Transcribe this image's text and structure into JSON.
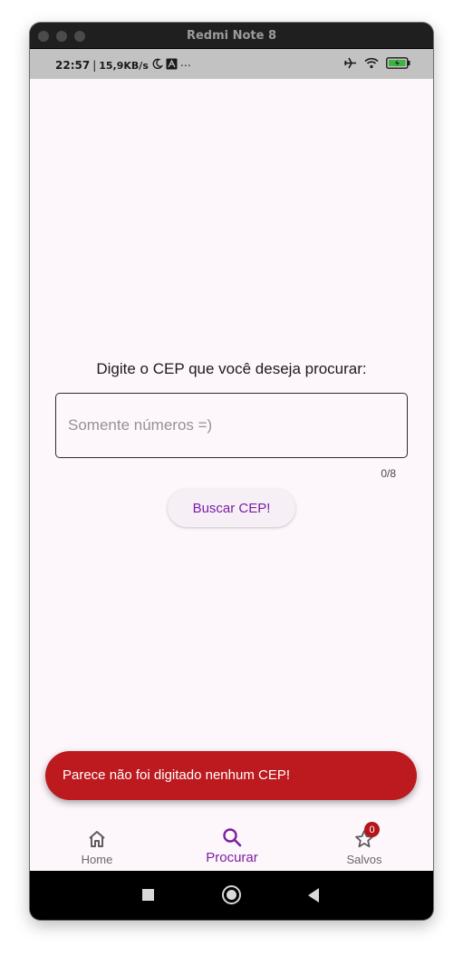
{
  "window": {
    "title": "Redmi Note 8"
  },
  "status_bar": {
    "time": "22:57",
    "separator": "|",
    "network_speed": "15,9KB/s",
    "more": "⋯",
    "icons": [
      "moon-icon",
      "app-notification-icon",
      "airplane-icon",
      "wifi-icon",
      "battery-charging-icon"
    ]
  },
  "screen": {
    "prompt": "Digite o CEP que você deseja procurar:",
    "cep_input": {
      "placeholder": "Somente números =)",
      "value": "",
      "counter": "0/8"
    },
    "search_button": {
      "label": "Buscar CEP!"
    },
    "snackbar": {
      "message": "Parece não foi digitado nenhum CEP!",
      "color": "#bc1a1e"
    }
  },
  "bottom_nav": {
    "items": [
      {
        "label": "Home",
        "icon": "home-icon",
        "active": false
      },
      {
        "label": "Procurar",
        "icon": "search-icon",
        "active": true
      },
      {
        "label": "Salvos",
        "icon": "star-icon",
        "active": false,
        "badge": "0"
      }
    ],
    "accent_color": "#7b1fa2"
  },
  "system_nav": {
    "icons": [
      "recents-icon",
      "home-circle-icon",
      "back-icon"
    ]
  }
}
